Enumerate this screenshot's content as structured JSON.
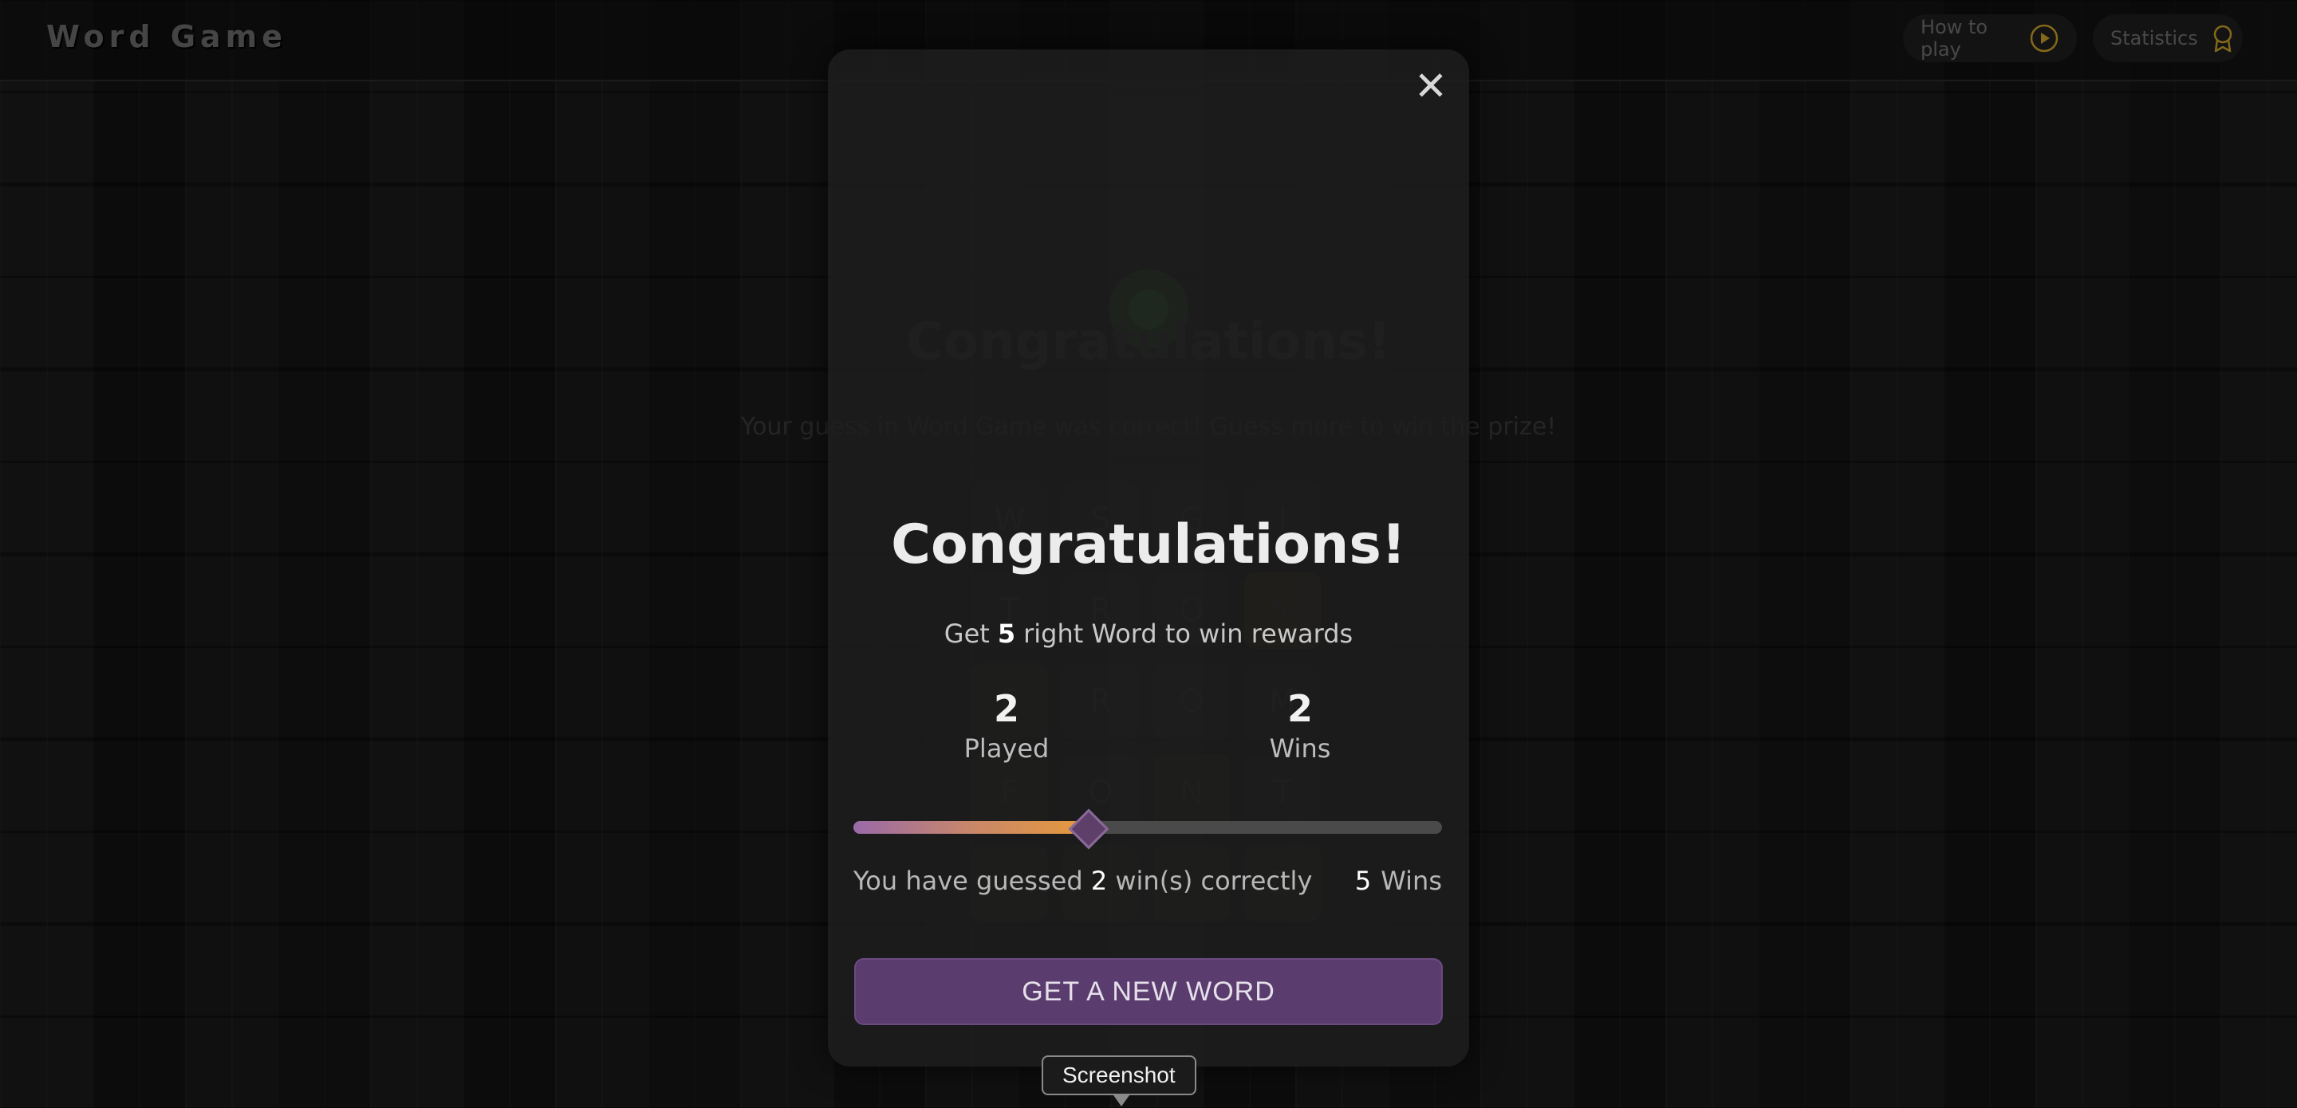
{
  "header": {
    "logo": "Word Game",
    "how_to_play": "How to play",
    "statistics": "Statistics"
  },
  "background": {
    "title": "Congratulations!",
    "subtitle": "Your guess in Word Game was correct! Guess more to win the prize!",
    "rows": [
      [
        "W",
        "S",
        "G",
        "I"
      ],
      [
        "T",
        "R",
        "O",
        "N"
      ],
      [
        "F",
        "R",
        "O",
        "M"
      ],
      [
        "F",
        "O",
        "N",
        "T"
      ],
      [
        "",
        "",
        "",
        "D"
      ]
    ]
  },
  "modal": {
    "title": "Congratulations!",
    "goal_prefix": "Get",
    "goal_count": "5",
    "goal_suffix": "right Word to win rewards",
    "played_value": "2",
    "played_label": "Played",
    "wins_value": "2",
    "wins_label": "Wins",
    "progress_fraction": 0.4,
    "guess_prefix": "You have guessed",
    "guess_count": "2",
    "guess_suffix": "win(s) correctly",
    "target_count": "5",
    "target_label": "Wins",
    "cta": "GET A NEW WORD"
  },
  "tooltip": "Screenshot",
  "colors": {
    "accent": "#5a3d6e",
    "icon_gold": "#c9a227"
  }
}
